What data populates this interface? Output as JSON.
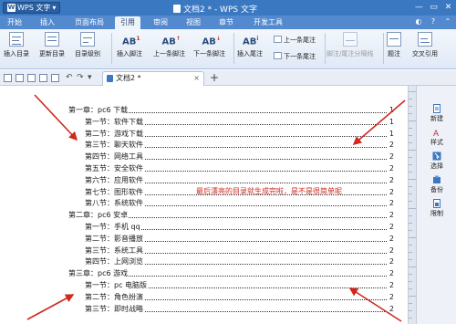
{
  "app": {
    "button_label": "WPS 文字",
    "title": "文档2 * - WPS 文字",
    "colors": {
      "titlebar": "#3b78c2",
      "menubar": "#5289cf",
      "annotation": "#d0281e"
    }
  },
  "menu": {
    "tabs": [
      {
        "label": "开始",
        "active": false
      },
      {
        "label": "插入",
        "active": false
      },
      {
        "label": "页面布局",
        "active": false
      },
      {
        "label": "引用",
        "active": true
      },
      {
        "label": "审阅",
        "active": false
      },
      {
        "label": "视图",
        "active": false
      },
      {
        "label": "章节",
        "active": false
      },
      {
        "label": "开发工具",
        "active": false
      }
    ]
  },
  "ribbon": {
    "insert_toc": "插入目录",
    "update_toc": "更新目录",
    "toc_level": "目录级别",
    "insert_footnote": "插入脚注",
    "prev_footnote": "上一条脚注",
    "next_footnote": "下一条脚注",
    "insert_endnote": "插入尾注",
    "prev_endnote": "上一条尾注",
    "next_endnote": "下一条尾注",
    "note_separator": "脚注/尾注分隔线",
    "caption": "题注",
    "cross_ref": "交叉引用"
  },
  "doc_tab": {
    "label": "文档2 *"
  },
  "toc": [
    {
      "text": "第一章：pc6 下载",
      "page": "1",
      "level": 1
    },
    {
      "text": "第一节：软件下载",
      "page": "1",
      "level": 2
    },
    {
      "text": "第二节：游戏下载",
      "page": "1",
      "level": 2
    },
    {
      "text": "第三节：聊天软件",
      "page": "2",
      "level": 2
    },
    {
      "text": "第四节：网络工具",
      "page": "2",
      "level": 2
    },
    {
      "text": "第五节：安全软件",
      "page": "2",
      "level": 2
    },
    {
      "text": "第六节：应用软件",
      "page": "2",
      "level": 2
    },
    {
      "text": "第七节：图形软件",
      "page": "2",
      "level": 2
    },
    {
      "text": "第八节：系统软件",
      "page": "2",
      "level": 2
    },
    {
      "text": "第二章：pc6 安卓",
      "page": "2",
      "level": 1
    },
    {
      "text": "第一节：手机 qq",
      "page": "2",
      "level": 2
    },
    {
      "text": "第二节：影音播放",
      "page": "2",
      "level": 2
    },
    {
      "text": "第三节：系统工具",
      "page": "2",
      "level": 2
    },
    {
      "text": "第四节：上网浏览",
      "page": "2",
      "level": 2
    },
    {
      "text": "第三章：pc6 游戏",
      "page": "2",
      "level": 1
    },
    {
      "text": "第一节：pc 电脑版",
      "page": "2",
      "level": 2
    },
    {
      "text": "第二节：角色扮演",
      "page": "2",
      "level": 2
    },
    {
      "text": "第三节：即时战略",
      "page": "2",
      "level": 2
    }
  ],
  "callout": "最后漂亮的目录就生成完啦，是不是很简单呢",
  "side_panel": {
    "items": [
      {
        "label": "新建",
        "icon": "new-doc-icon"
      },
      {
        "label": "样式",
        "icon": "style-icon"
      },
      {
        "label": "选择",
        "icon": "select-icon"
      },
      {
        "label": "备份",
        "icon": "backup-icon"
      },
      {
        "label": "限制",
        "icon": "restrict-icon"
      }
    ]
  }
}
